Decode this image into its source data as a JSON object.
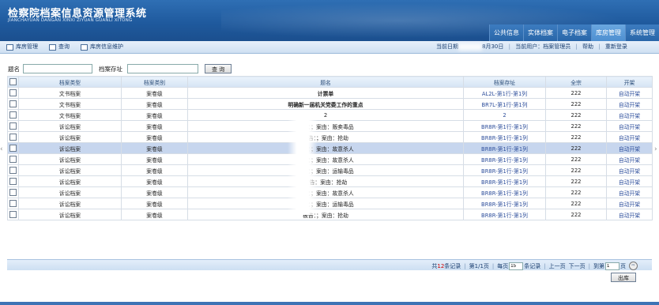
{
  "app": {
    "title": "检察院档案信息资源管理系统",
    "subtitle": "JIANCHAYUAN DANGAN XINXI ZIYUAN GUANLI XITONG"
  },
  "topnav": [
    "公共信息",
    "实体档案",
    "电子档案",
    "库房管理",
    "系统管理"
  ],
  "topnav_active": "库房管理",
  "toolbar": {
    "items": [
      "库房管理",
      "查询",
      "库房信息维护"
    ],
    "date_label": "当前日期",
    "date_value": "8月30日",
    "user_label": "当前用户：档案管理员",
    "help": "帮助",
    "relogin": "重新登录"
  },
  "search": {
    "title_label": "题名",
    "title_value": "",
    "location_label": "档案存址",
    "location_value": "",
    "button": "查 询"
  },
  "table": {
    "headers": [
      "档案类型",
      "档案类别",
      "题名",
      "档案存址",
      "全宗",
      "开架"
    ],
    "rows": [
      {
        "type": "文书档案",
        "category": "案卷级",
        "title": "计票单",
        "location": "AL2L-第1行-第1列",
        "fonds": "222",
        "action": "自动开架"
      },
      {
        "type": "文书档案",
        "category": "案卷级",
        "title": "明确新一届机关党委工作的重点",
        "location": "BR7L-第1行-第1列",
        "fonds": "222",
        "action": "自动开架"
      },
      {
        "type": "文书档案",
        "category": "案卷级",
        "title": "2",
        "location": "2",
        "fonds": "222",
        "action": "自动开架"
      },
      {
        "type": "诉讼档案",
        "category": "案卷级",
        "title": "被告：；案由：贩卖毒品",
        "location": "BR8R-第1行-第1列",
        "fonds": "222",
        "action": "自动开架"
      },
      {
        "type": "诉讼档案",
        "category": "案卷级",
        "title": "被告：；案由：抢劫",
        "location": "BR8R-第1行-第1列",
        "fonds": "222",
        "action": "自动开架"
      },
      {
        "type": "诉讼档案",
        "category": "案卷级",
        "title": "被告：；案由：故意杀人",
        "location": "BR8R-第1行-第1列",
        "fonds": "222",
        "action": "自动开架"
      },
      {
        "type": "诉讼档案",
        "category": "案卷级",
        "title": "被告：；案由：故意杀人",
        "location": "BR8R-第1行-第1列",
        "fonds": "222",
        "action": "自动开架"
      },
      {
        "type": "诉讼档案",
        "category": "案卷级",
        "title": "被告：；案由：运输毒品",
        "location": "BR8R-第1行-第1列",
        "fonds": "222",
        "action": "自动开架"
      },
      {
        "type": "诉讼档案",
        "category": "案卷级",
        "title": "被告：案由：抢劫",
        "location": "BR8R-第1行-第1列",
        "fonds": "222",
        "action": "自动开架"
      },
      {
        "type": "诉讼档案",
        "category": "案卷级",
        "title": "被告：；案由：故意杀人",
        "location": "BR8R-第1行-第1列",
        "fonds": "222",
        "action": "自动开架"
      },
      {
        "type": "诉讼档案",
        "category": "案卷级",
        "title": "被告：；案由：运输毒品",
        "location": "BR8R-第1行-第1列",
        "fonds": "222",
        "action": "自动开架"
      },
      {
        "type": "诉讼档案",
        "category": "案卷级",
        "title": "被告：；案由：抢劫",
        "location": "BR8R-第1行-第1列",
        "fonds": "222",
        "action": "自动开架"
      }
    ],
    "selected_row": 5
  },
  "pager": {
    "total_prefix": "共",
    "total": "12",
    "total_suffix": "条记录",
    "page_info": "第1/1页",
    "per_page_prefix": "每页",
    "per_page": "15",
    "per_page_suffix": "条记录",
    "prev": "上一页",
    "next": "下一页",
    "jump_prefix": "到第",
    "jump_value": "1",
    "jump_suffix": "页"
  },
  "actions": {
    "out": "出库"
  }
}
